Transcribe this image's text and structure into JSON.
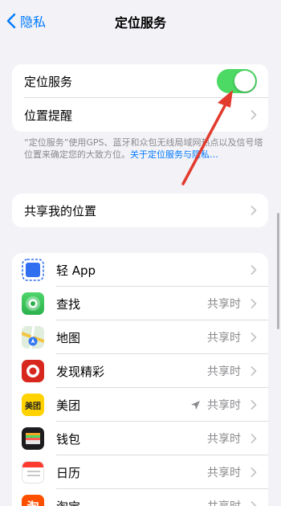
{
  "nav": {
    "back_label": "隐私",
    "title": "定位服务"
  },
  "location_group": {
    "location_services_label": "定位服务",
    "location_services_on": true,
    "location_alerts_label": "位置提醒"
  },
  "footnote": {
    "text": "“定位服务”使用GPS、蓝牙和众包无线局域网热点以及信号塔位置来确定您的大致方位。",
    "link": "关于定位服务与隐私…"
  },
  "share_group": {
    "share_location_label": "共享我的位置"
  },
  "apps": [
    {
      "name": "轻 App",
      "status": ""
    },
    {
      "name": "查找",
      "status": "共享时"
    },
    {
      "name": "地图",
      "status": "共享时"
    },
    {
      "name": "发现精彩",
      "status": "共享时"
    },
    {
      "name": "美团",
      "status": "共享时",
      "location_arrow": true,
      "icon_text": "美团"
    },
    {
      "name": "钱包",
      "status": "共享时"
    },
    {
      "name": "日历",
      "status": "共享时"
    },
    {
      "name": "淘宝",
      "status": "共享时",
      "icon_text": "淘"
    }
  ],
  "colors": {
    "accent": "#007aff",
    "toggle_on": "#4cd964",
    "annotation_arrow": "#e23b2e"
  }
}
